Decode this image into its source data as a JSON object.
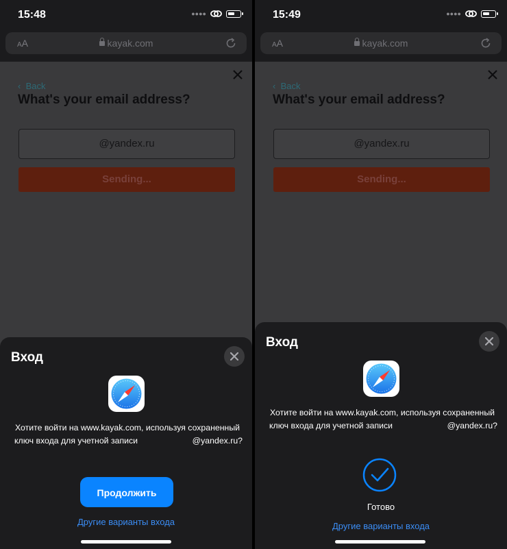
{
  "left": {
    "status": {
      "time": "15:48"
    },
    "browser": {
      "aa_small": "A",
      "aa_large": "A",
      "url": "kayak.com"
    },
    "web": {
      "back": "Back",
      "title": "What's your email address?",
      "email": "@yandex.ru",
      "sending": "Sending..."
    },
    "sheet": {
      "title": "Вход",
      "message_line1": "Хотите войти на www.kayak.com, используя сохраненный",
      "message_line2a": "ключ входа для учетной записи",
      "message_line2b": "@yandex.ru?",
      "continue": "Продолжить",
      "other": "Другие варианты входа"
    }
  },
  "right": {
    "status": {
      "time": "15:49"
    },
    "browser": {
      "aa_small": "A",
      "aa_large": "A",
      "url": "kayak.com"
    },
    "web": {
      "back": "Back",
      "title": "What's your email address?",
      "email": "@yandex.ru",
      "sending": "Sending..."
    },
    "sheet": {
      "title": "Вход",
      "message_line1": "Хотите войти на www.kayak.com, используя сохраненный",
      "message_line2a": "ключ входа для учетной записи",
      "message_line2b": "@yandex.ru?",
      "done": "Готово",
      "other": "Другие варианты входа"
    }
  },
  "colors": {
    "accent": "#0a84ff",
    "sheet_bg": "#1c1c1e",
    "link": "#3b8df5",
    "sending_btn": "#5e1f0e"
  },
  "icons": [
    "signal-dots-icon",
    "link-icon",
    "battery-icon",
    "lock-icon",
    "reload-icon",
    "close-icon",
    "safari-icon",
    "checkmark-icon"
  ]
}
